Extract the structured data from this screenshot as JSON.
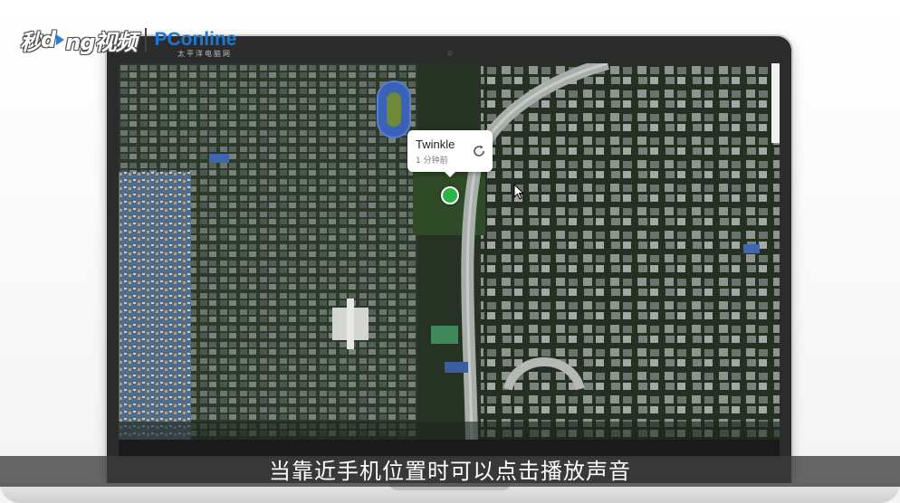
{
  "watermark": {
    "brand_left": "秒",
    "brand_left_mid": "d",
    "brand_left_end": "ng视频",
    "brand_right_p": "P",
    "brand_right_rest": "Conline",
    "brand_right_sub": "太平洋电脑网"
  },
  "popup": {
    "name": "Twinkle",
    "time": "1 分钟前",
    "refresh_icon": "refresh-icon"
  },
  "marker": {
    "color": "#2db24a",
    "icon": "location-dot-icon"
  },
  "subtitle": {
    "text": "当靠近手机位置时可以点击播放声音"
  },
  "colors": {
    "subtitle_bar": "#3c3c3c",
    "brand_blue": "#1f77d4",
    "brand_red": "#e33b2f"
  }
}
